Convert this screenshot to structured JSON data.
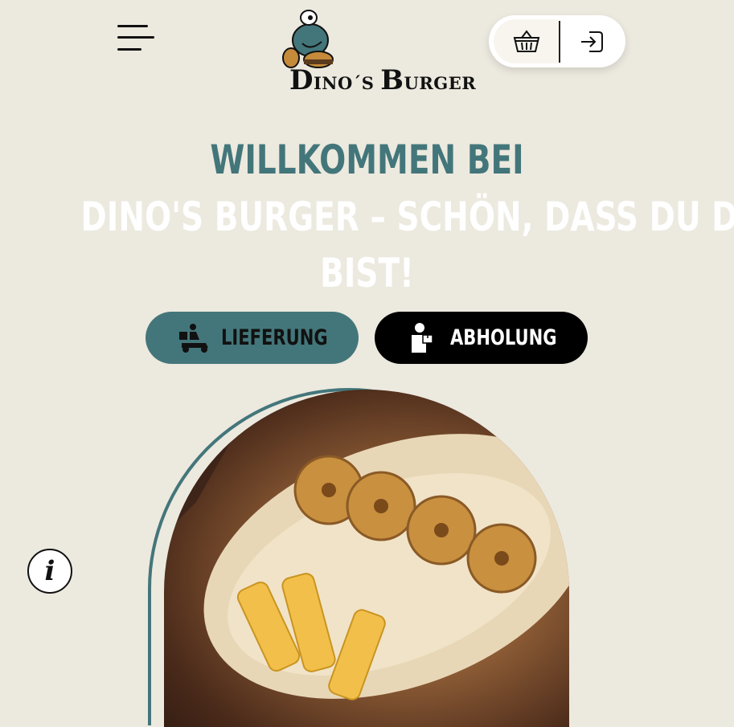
{
  "header": {
    "logo_text_big_1": "D",
    "logo_text_small_1": "INO´S ",
    "logo_text_big_2": "B",
    "logo_text_small_2": "URGER",
    "menu_icon": "hamburger-menu-icon",
    "cart_icon": "basket-icon",
    "login_icon": "login-icon"
  },
  "hero": {
    "welcome": "Willkommen bei",
    "subtitle_line1": "Dino's Burger – schön, dass du da",
    "subtitle_line2": "bist!"
  },
  "order_buttons": {
    "delivery_label": "Lieferung",
    "pickup_label": "Abholung",
    "delivery_icon": "scooter-delivery-icon",
    "pickup_icon": "pickup-person-icon"
  },
  "info": {
    "icon_glyph": "i",
    "icon": "info-icon"
  },
  "colors": {
    "background": "#ece9df",
    "accent": "#43767a",
    "black": "#000000",
    "white": "#ffffff"
  }
}
